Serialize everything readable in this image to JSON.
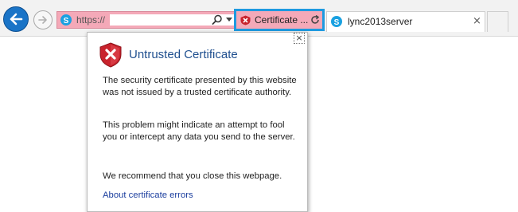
{
  "toolbar": {
    "address": {
      "url_prefix": "https://",
      "icon": "skype-icon"
    },
    "certificate_button": {
      "label": "Certificate ...",
      "icon": "certificate-error-icon"
    },
    "tab": {
      "title": "lync2013server",
      "close": "×"
    }
  },
  "popup": {
    "close": "×",
    "title": "Untrusted Certificate",
    "paragraph1": "The security certificate presented by this website was not issued by a trusted certificate authority.",
    "paragraph2": "This problem might indicate an attempt to fool you or intercept any data you send to the server.",
    "paragraph3": "We recommend that you close this webpage.",
    "link": "About certificate errors"
  },
  "colors": {
    "back_button": "#1a74c7",
    "address_error_bg": "#f4a9b8",
    "highlight_border": "#1e9ae0",
    "title": "#1f4f8f",
    "link": "#1a3d9e"
  }
}
